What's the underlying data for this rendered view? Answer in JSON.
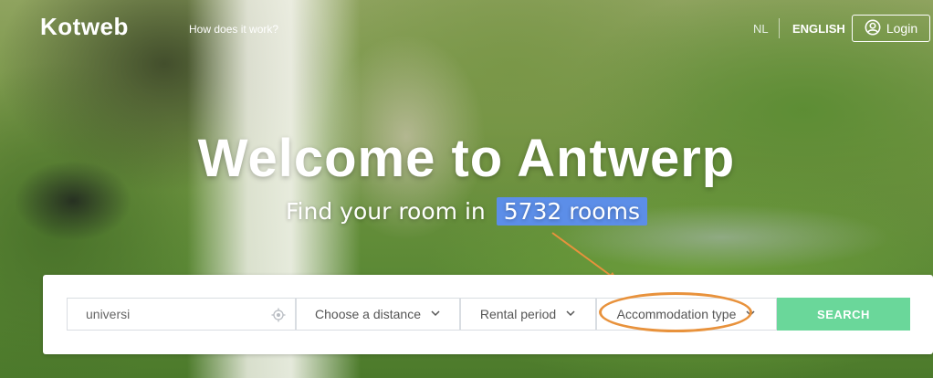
{
  "header": {
    "logo": "Kotweb",
    "how_link": "How does it work?",
    "lang_nl": "NL",
    "lang_english": "ENGLISH",
    "login_label": "Login"
  },
  "hero": {
    "title": "Welcome to Antwerp",
    "subtitle_prefix": "Find your room in",
    "room_count": "5732 rooms"
  },
  "search": {
    "location_value": "universi",
    "distance_label": "Choose a distance",
    "period_label": "Rental period",
    "accommodation_label": "Accommodation type",
    "search_label": "SEARCH"
  },
  "colors": {
    "count_highlight": "#5c8ee8",
    "search_button": "#6ad79a",
    "annotation": "#e8923c"
  },
  "icons": [
    "user-circle-icon",
    "location-target-icon",
    "chevron-down-icon"
  ]
}
